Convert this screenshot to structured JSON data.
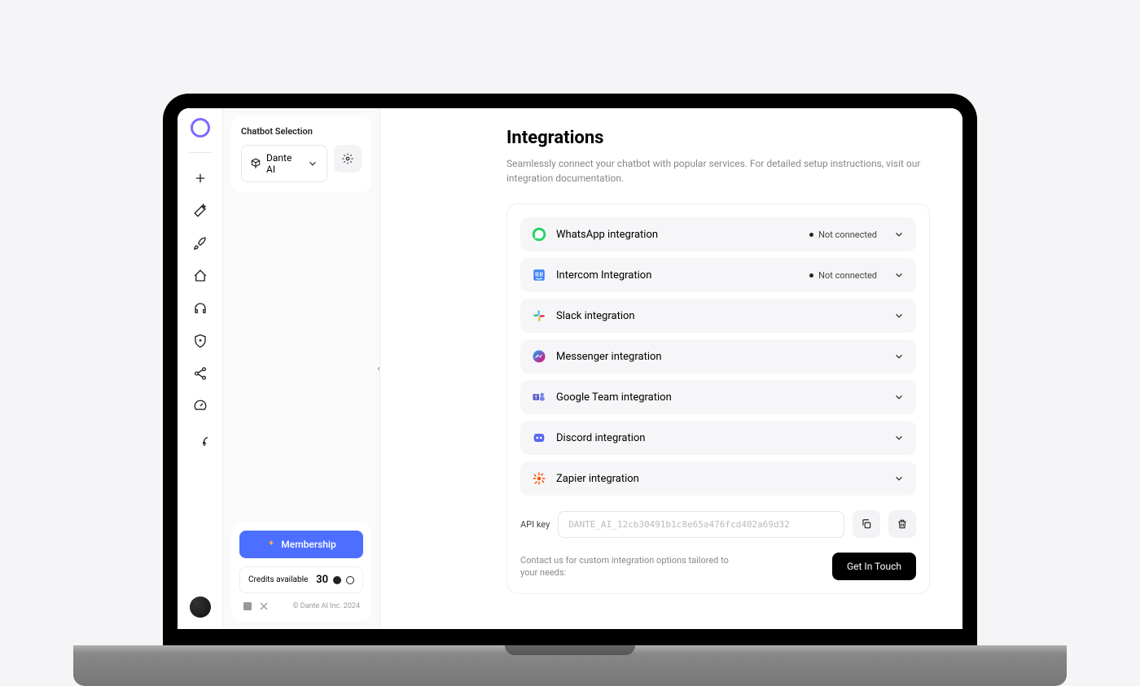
{
  "sidebar": {
    "chatbot_selection_label": "Chatbot Selection",
    "selected_chatbot": "Dante AI",
    "membership_label": "Membership",
    "credits_label": "Credits available",
    "credits_value": "30",
    "copyright": "© Dante AI Inc. 2024"
  },
  "page": {
    "title": "Integrations",
    "subtitle": "Seamlessly connect your chatbot with popular services. For detailed setup instructions, visit our integration documentation."
  },
  "integrations": [
    {
      "name": "WhatsApp integration",
      "status": "Not connected",
      "icon": "whatsapp"
    },
    {
      "name": "Intercom Integration",
      "status": "Not connected",
      "icon": "intercom"
    },
    {
      "name": "Slack integration",
      "status": "",
      "icon": "slack"
    },
    {
      "name": "Messenger integration",
      "status": "",
      "icon": "messenger"
    },
    {
      "name": "Google Team integration",
      "status": "",
      "icon": "teams"
    },
    {
      "name": "Discord integration",
      "status": "",
      "icon": "discord"
    },
    {
      "name": "Zapier integration",
      "status": "",
      "icon": "zapier"
    }
  ],
  "api": {
    "label": "API key",
    "value": "DANTE_AI_12cb30491b1c8e65a476fcd402a69d32"
  },
  "contact": {
    "text": "Contact us for custom integration options tailored to your needs:",
    "button": "Get In Touch"
  }
}
